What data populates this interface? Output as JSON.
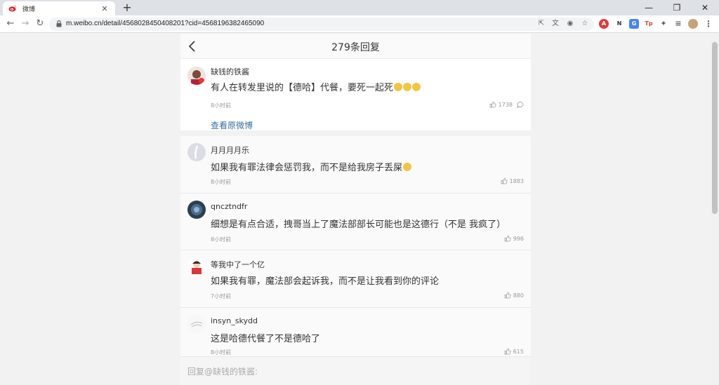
{
  "browser": {
    "tab_title": "微博",
    "url": "m.weibo.cn/detail/4568028450408201?cid=4568196382465090"
  },
  "header": {
    "title": "279条回复"
  },
  "original": {
    "username": "缺钱的铁酱",
    "text": "有人在转发里说的【德哈】代餐，要死一起死",
    "time": "8小时前",
    "likes": "1738",
    "view_original": "查看原微博"
  },
  "comments": [
    {
      "username": "月月月月乐",
      "text": "如果我有罪法律会惩罚我，而不是给我房子丢屎",
      "time": "8小时前",
      "likes": "1883"
    },
    {
      "username": "qncztndfr",
      "text": "细想是有点合适，拽哥当上了魔法部部长可能也是这德行（不是 我疯了）",
      "time": "8小时前",
      "likes": "996"
    },
    {
      "username": "等我中了一个亿",
      "text": "如果我有罪，魔法部会起诉我，而不是让我看到你的评论",
      "time": "7小时前",
      "likes": "880"
    },
    {
      "username": "insyn_skydd",
      "text": "这是哈德代餐了不是德哈了",
      "time": "8小时前",
      "likes": "615"
    }
  ],
  "reply_bar": {
    "placeholder": "回复@缺钱的铁酱:"
  }
}
